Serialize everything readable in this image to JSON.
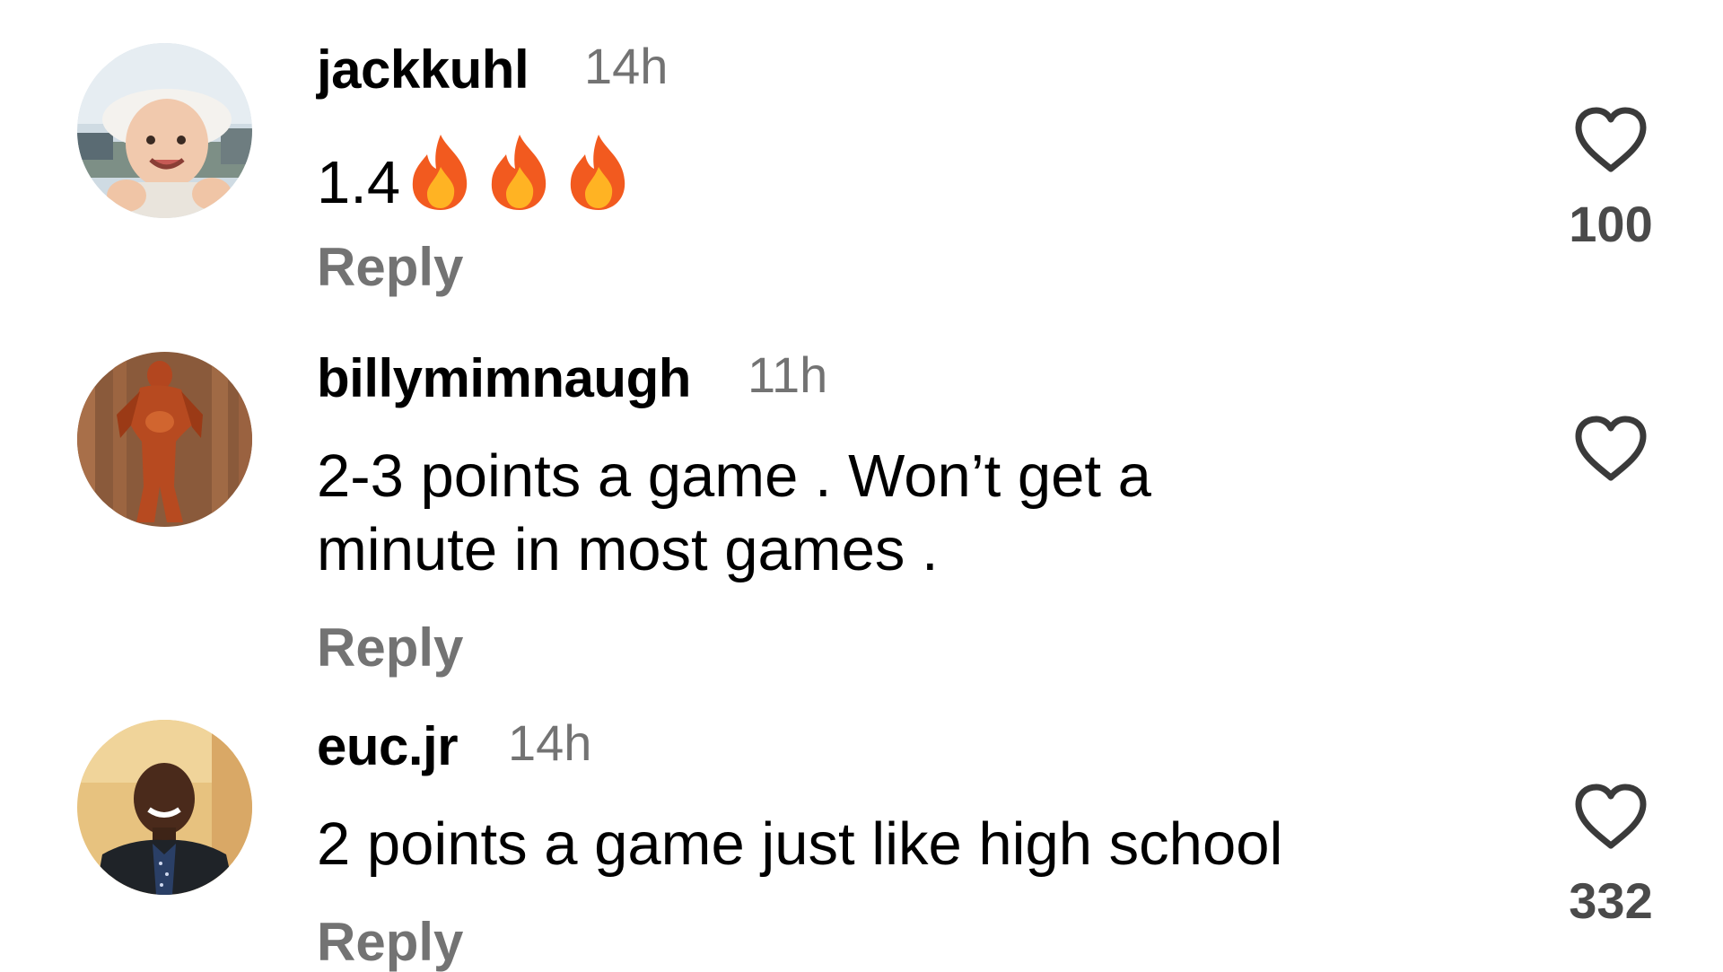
{
  "comments": [
    {
      "username": "jackkuhl",
      "time": "14h",
      "text": "1.4",
      "emoji_suffix": [
        "fire",
        "fire",
        "fire"
      ],
      "reply_label": "Reply",
      "likes": "100"
    },
    {
      "username": "billymimnaugh",
      "time": "11h",
      "text_line1": "2-3 points a game . Won’t get a",
      "text_line2": "minute in most games .",
      "reply_label": "Reply",
      "likes": ""
    },
    {
      "username": "euc.jr",
      "time": "14h",
      "text": "2 points a game just like high school",
      "reply_label": "Reply",
      "likes": "332"
    }
  ],
  "icons": {
    "like": "heart-outline-icon",
    "emoji": "fire-emoji-icon"
  },
  "colors": {
    "text": "#000000",
    "muted": "#737373",
    "count": "#4a4a4a"
  }
}
